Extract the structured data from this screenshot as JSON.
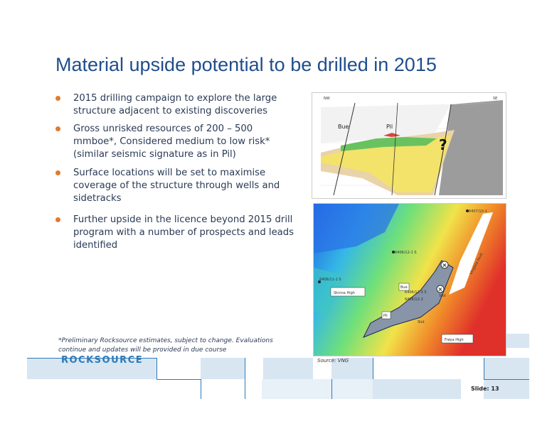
{
  "slide": {
    "title": "Material upside potential to be drilled in 2015",
    "bullets": [
      "2015 drilling campaign to explore the large structure adjacent to existing discoveries",
      "Gross unrisked resources of 200 – 500 mmboe*, Considered medium to low risk* (similar seismic signature as in Pil)",
      "Surface locations will be set to maximise coverage of the structure through wells and sidetracks",
      "Further upside in the licence beyond 2015 drill program with a number of prospects and leads identified"
    ],
    "footnote": "*Preliminary Rocksource estimates, subject to change. Evaluations continue and updates will be provided in due course",
    "logo_text": "ROCKSOURCE",
    "source": "Source: VNG",
    "slide_number": "Slide: 13"
  },
  "cross_section": {
    "left_label": "NW",
    "right_label": "SE",
    "bue_label": "Bue",
    "pil_label": "Pil",
    "question_mark": "?"
  },
  "map": {
    "labels": {
      "skinna_high": "Skinna High",
      "frøya_high": "Frøya High",
      "vingleia_fault": "Vingleia Fault",
      "slot_1": "Slot",
      "slot_2": "Slot",
      "bue": "Bue",
      "pil": "Pil"
    },
    "wells": {
      "w1": "6406/12-1 S",
      "w2": "6406/11-1 S",
      "w3": "6406/12-3 S",
      "w4": "6406/12-2",
      "w5": "6407/10-1"
    }
  },
  "colors": {
    "title": "#1f4e8c",
    "bullet": "#e07a2e",
    "accent_blue": "#2f7ab8",
    "block": "#d8e6f2"
  }
}
